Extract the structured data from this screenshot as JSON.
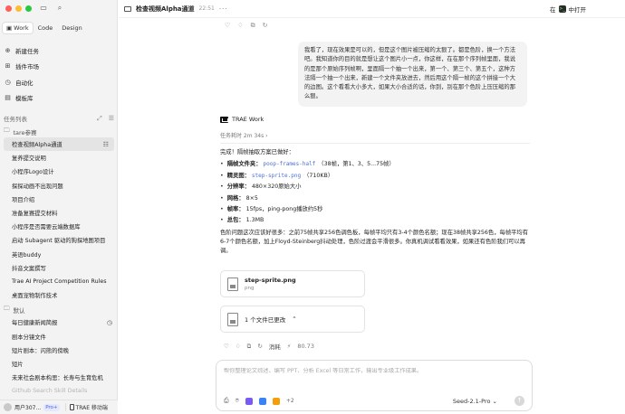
{
  "sidebar": {
    "mode_tabs": [
      {
        "label": "Work",
        "active": true
      },
      {
        "label": "Code",
        "active": false
      },
      {
        "label": "Design",
        "active": false
      }
    ],
    "nav": [
      {
        "icon": "new-task-icon",
        "label": "新建任务"
      },
      {
        "icon": "plugin-icon",
        "label": "插件市场"
      },
      {
        "icon": "automation-icon",
        "label": "自动化"
      },
      {
        "icon": "template-icon",
        "label": "模板库"
      }
    ],
    "task_list_title": "任务列表",
    "folder1": "tare参赛",
    "tasks1": [
      {
        "label": "检查视频Alpha通道",
        "active": true
      },
      {
        "label": "复养提交说明",
        "active": false
      },
      {
        "label": "小程序Logo设计",
        "active": false
      },
      {
        "label": "探探动画不出现问题",
        "active": false
      },
      {
        "label": "项目介绍",
        "active": false
      },
      {
        "label": "准备复赛提交材料",
        "active": false
      },
      {
        "label": "小程序是否需要云端数据库",
        "active": false
      },
      {
        "label": "启动 Subagent 驱动的狗探地图项目",
        "active": false
      },
      {
        "label": "英语buddy",
        "active": false
      },
      {
        "label": "抖音文案撰写",
        "active": false
      },
      {
        "label": "Trae AI Project Competition Rules",
        "active": false
      },
      {
        "label": "桌面宠物制作技术",
        "active": false
      }
    ],
    "folder2": "默认",
    "tasks2": [
      {
        "label": "每日健康新闻简报",
        "scheduled": true
      },
      {
        "label": "剧本分镜文件",
        "scheduled": false
      },
      {
        "label": "短片剧本：闪熊的傍晚",
        "scheduled": false
      },
      {
        "label": "短片",
        "scheduled": false
      },
      {
        "label": "未来社会剧本构思：长寿与生育危机",
        "scheduled": false
      },
      {
        "label": "Github Search Skill Details",
        "scheduled": false,
        "faded": true
      }
    ],
    "user_name": "用户307...",
    "plan_badge": "Pro+",
    "mobile_label": "TRAE 移动端"
  },
  "header": {
    "title": "检查视频Alpha通道",
    "time": "22:51",
    "open_in_prefix": "在",
    "open_in_label": "中打开"
  },
  "conversation": {
    "user_message": "我看了，现在效果是可以的，但是这个图片被压缩的太狠了。都是色阶，换一个方法吧。我知道你的目的就是想让这个图片小一点，你这样，在在那个序列帧里面，我说的是那个原始序列帧啊，里面隔一个抽一个出来，第一个、第三个、第五个，这种方法隔一个抽一个出来，新建一个文件夹放进去，然后用这个隔一帧的这个拼接一个大的边图。这个看看大小多大，如果大小合适的话，你到，别在那个色阶上压压缩的那么狠。",
    "agent_name": "TRAE Work",
    "elapsed": "任务耗时 2m 34s",
    "intro": "完成！隔帧抽取方案已做好：",
    "bullets": [
      {
        "label": "隔帧文件夹：",
        "code": "poop-frames-half",
        "text": "（38帧，第1、3、5...75帧）"
      },
      {
        "label": "精灵图：",
        "code": "step-sprite.png",
        "text": "（710KB）"
      },
      {
        "label": "分辨率：",
        "code": "",
        "text": "480×320原始大小"
      },
      {
        "label": "网格：",
        "code": "",
        "text": "8×5"
      },
      {
        "label": "帧率：",
        "code": "",
        "text": "15fps，ping-pong播放约5秒"
      },
      {
        "label": "总包：",
        "code": "",
        "text": "1.3MB"
      }
    ],
    "note": "色阶问题这次应该好很多：之前75帧共享256色调色板，每帧平均只有3-4个颜色名额；现在38帧共享256色，每帧平均有6-7个颜色名额，加上Floyd-Steinberg抖动处理，色阶过渡会平滑很多。你真机调试看看效果，如果还有色阶我们可以再调。",
    "file_name": "step-sprite.png",
    "file_ext": "png",
    "changes": "1 个文件已更改",
    "undo_label": "消耗",
    "cost": "80.73"
  },
  "composer": {
    "placeholder": "帮你整理论文综述、编写 PPT、分析 Excel 等日常工作，输出专业级工作成果。",
    "extra_count": "+2",
    "model": "Seed-2.1-Pro"
  }
}
